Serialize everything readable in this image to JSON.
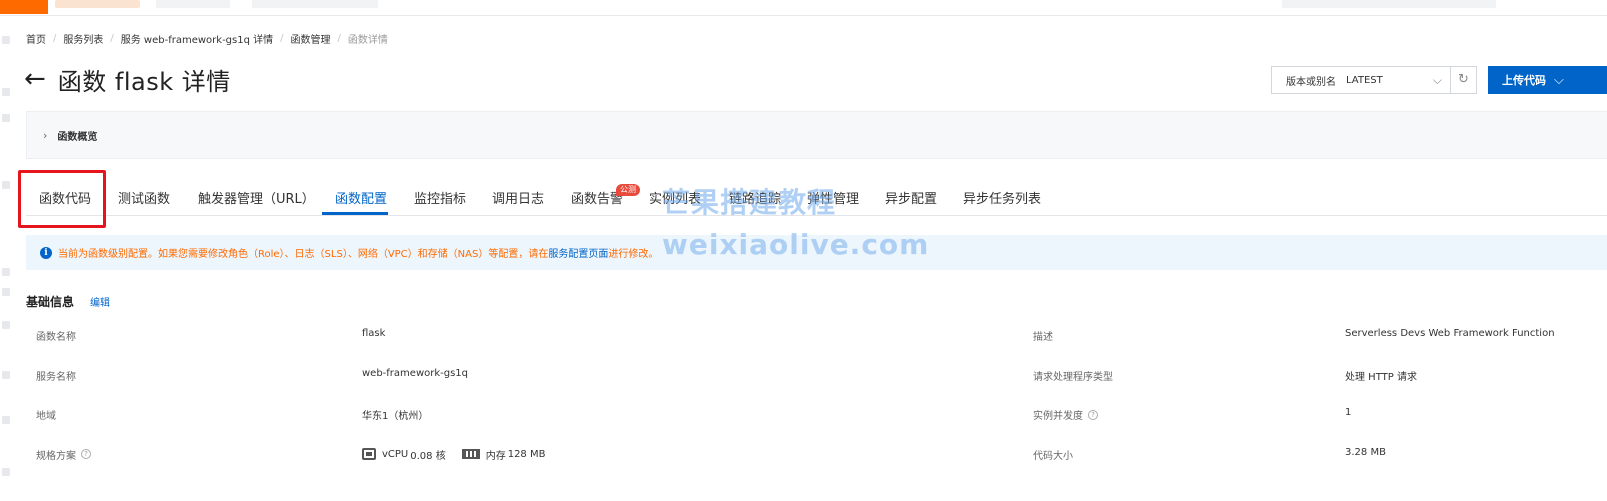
{
  "breadcrumb": {
    "home": "首页",
    "service_list": "服务列表",
    "service_detail": "服务 web-framework-gs1q 详情",
    "function_mgmt": "函数管理",
    "current": "函数详情"
  },
  "header": {
    "title": "函数 flask 详情",
    "version_label": "版本或别名",
    "version_value": "LATEST",
    "upload_label": "上传代码"
  },
  "overview": {
    "label": "函数概览"
  },
  "tabs": [
    {
      "label": "函数代码"
    },
    {
      "label": "测试函数"
    },
    {
      "label": "触发器管理（URL）"
    },
    {
      "label": "函数配置"
    },
    {
      "label": "监控指标"
    },
    {
      "label": "调用日志"
    },
    {
      "label": "函数告警"
    },
    {
      "label": "实例列表"
    },
    {
      "label": "链路追踪"
    },
    {
      "label": "弹性管理"
    },
    {
      "label": "异步配置"
    },
    {
      "label": "异步任务列表"
    }
  ],
  "active_tab": "函数配置",
  "alarm_badge": "公测",
  "notice": {
    "text_before": "当前为函数级别配置。如果您需要修改角色（Role）、日志（SLS）、网络（VPC）和存储（NAS）等配置，请在",
    "link": "服务配置页面",
    "text_after": "进行修改。"
  },
  "watermark": {
    "line1": "芒果搭建教程",
    "line2": "weixiaolive.com"
  },
  "basic_info": {
    "title": "基础信息",
    "edit": "编辑",
    "rows": [
      {
        "k1": "函数名称",
        "v1": "flask",
        "k2": "描述",
        "v2": "Serverless Devs Web Framework Function"
      },
      {
        "k1": "服务名称",
        "v1": "web-framework-gs1q",
        "k2": "请求处理程序类型",
        "v2": "处理 HTTP 请求"
      },
      {
        "k1": "地域",
        "v1": "华东1（杭州）",
        "k2": "实例并发度",
        "v2": "1"
      },
      {
        "k1": "规格方案",
        "v1_cpu_label": "vCPU",
        "v1_cpu_value": "0.08 核",
        "v1_mem_label": "内存",
        "v1_mem_value": "128 MB",
        "k2": "代码大小",
        "v2": "3.28 MB"
      }
    ]
  },
  "colors": {
    "primary": "#0064c8",
    "brand": "#ff6a00",
    "highlight": "#e5141d",
    "badge": "#e84a3c"
  },
  "icons": [
    "back-arrow-icon",
    "chevron-down-icon",
    "refresh-icon",
    "chevron-right-icon",
    "info-icon",
    "help-icon",
    "cpu-chip-icon",
    "memory-icon"
  ]
}
